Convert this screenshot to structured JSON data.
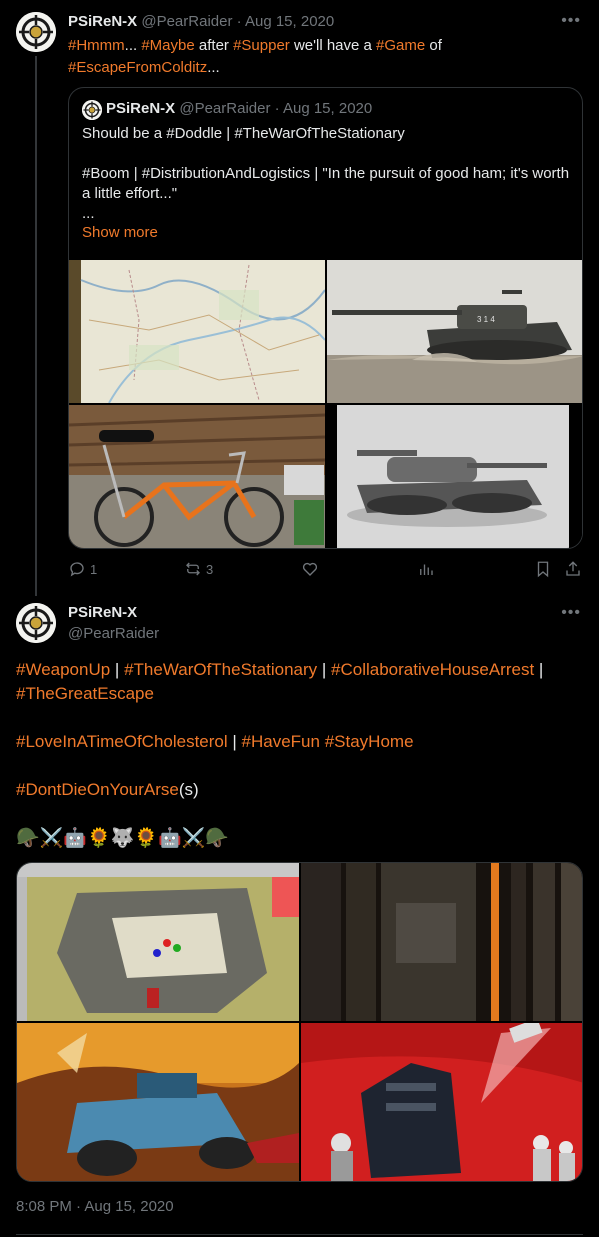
{
  "tweet1": {
    "name": "PSiReN-X",
    "handle": "@PearRaider",
    "date": "Aug 15, 2020",
    "text": {
      "t1": "#Hmmm",
      "t2": "... ",
      "t3": "#Maybe",
      "t4": " after ",
      "t5": "#Supper",
      "t6": " we'll have a ",
      "t7": "#Game",
      "t8": " of",
      "t9": "#EscapeFromColditz",
      "t10": "..."
    },
    "quote": {
      "name": "PSiReN-X",
      "handle": "@PearRaider",
      "date": "Aug 15, 2020",
      "line1": "Should be a #Doddle | #TheWarOfTheStationary",
      "line2": "#Boom | #DistributionAndLogistics | \"In the pursuit of good ham; it's worth a little effort...\"",
      "line3": "...",
      "show_more": "Show more"
    },
    "actions": {
      "replies": "1",
      "reposts": "3",
      "likes": "",
      "views": ""
    }
  },
  "tweet2": {
    "name": "PSiReN-X",
    "handle": "@PearRaider",
    "line1": {
      "a": "#WeaponUp",
      "b": " | ",
      "c": "#TheWarOfTheStationary",
      "d": " | ",
      "e": "#CollaborativeHouseArrest",
      "f": " |"
    },
    "line2": "#TheGreatEscape",
    "line3": {
      "a": "#LoveInATimeOfCholesterol",
      "b": " | ",
      "c": "#HaveFun",
      "d": " ",
      "e": "#StayHome"
    },
    "line4": {
      "a": "#DontDieOnYourArse",
      "b": "(s)"
    },
    "emoji": "🪖⚔️🤖🌻🐺🌻🤖⚔️🪖",
    "timestamp": "8:08 PM · Aug 15, 2020"
  },
  "colors": {
    "accent": "#f07a2c",
    "muted": "#71767b",
    "background": "#000000",
    "border": "#2f3336"
  },
  "icons": {
    "reply": "reply-icon",
    "repost": "repost-icon",
    "like": "heart-icon",
    "views": "views-icon",
    "bookmark": "bookmark-icon",
    "share": "share-icon",
    "more": "more-icon"
  }
}
